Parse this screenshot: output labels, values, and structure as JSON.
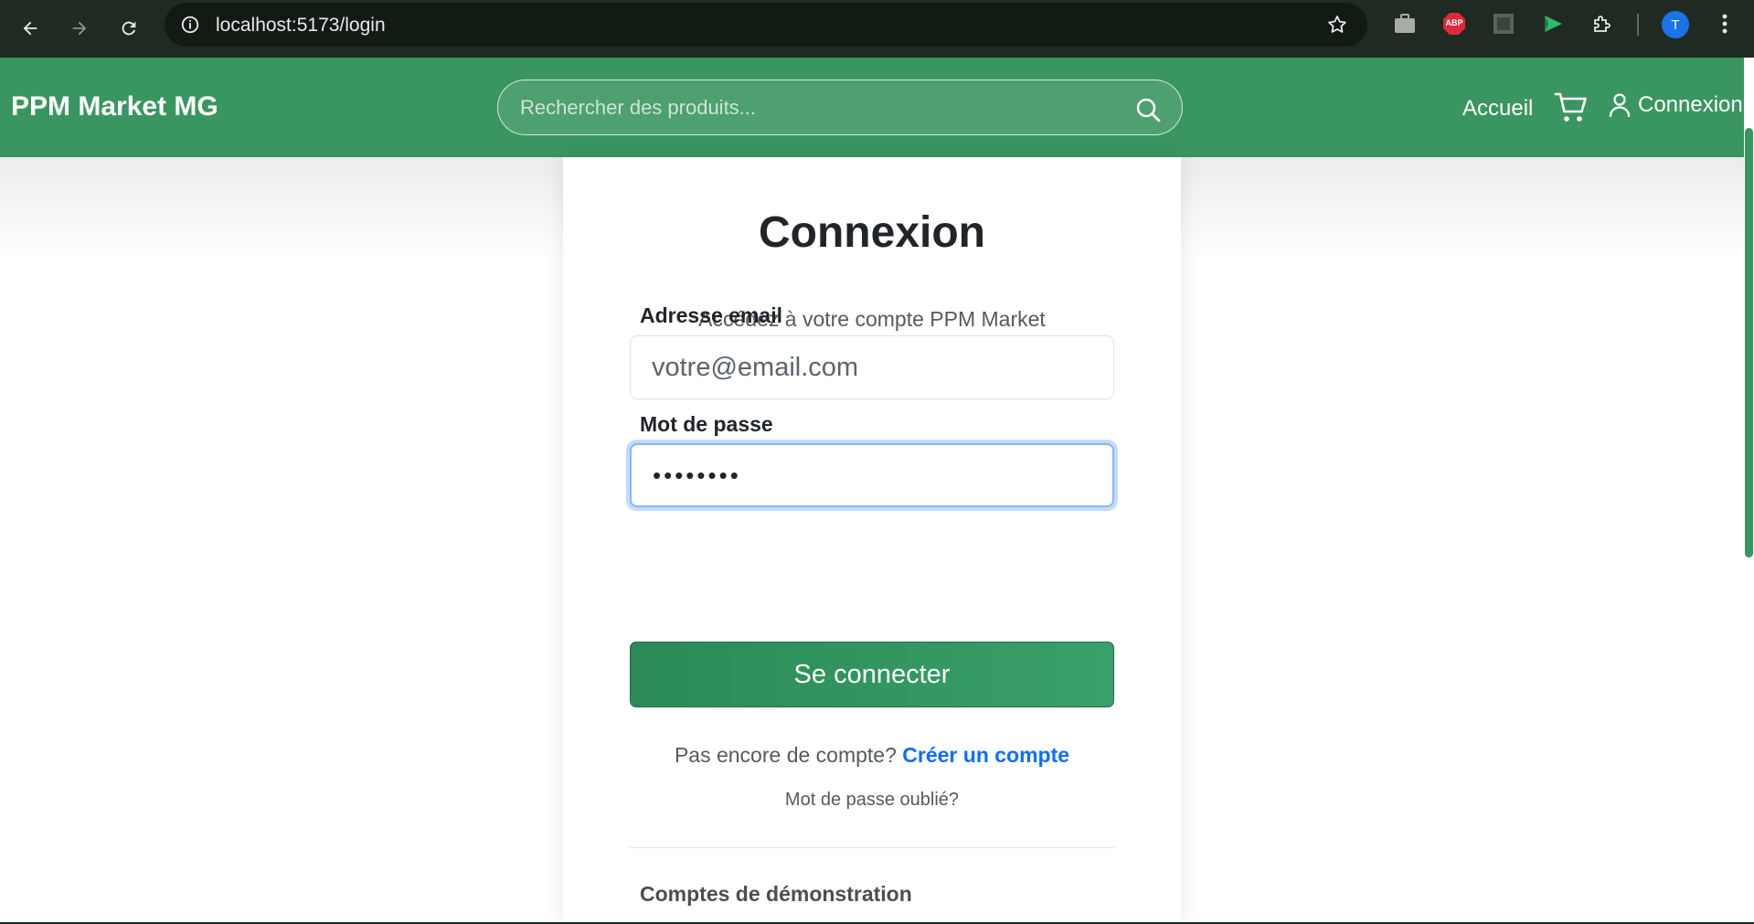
{
  "browser": {
    "url": "localhost:5173/login",
    "profile_initial": "T",
    "extensions": [
      "briefcase-icon",
      "adblock-plus-icon",
      "seo-icon",
      "send-icon",
      "puzzle-icon"
    ],
    "abp_label": "ABP"
  },
  "header": {
    "brand": "PPM Market MG",
    "search_placeholder": "Rechercher des produits...",
    "nav_home": "Accueil",
    "nav_login": "Connexion",
    "accent_color": "#3a9660"
  },
  "login": {
    "title": "Connexion",
    "subtitle": "Accédez à votre compte PPM Market",
    "email_label": "Adresse email",
    "email_placeholder": "votre@email.com",
    "password_label": "Mot de passe",
    "password_value": "••••••••",
    "submit_label": "Se connecter",
    "no_account_text": "Pas encore de compte?",
    "create_account_link": "Créer un compte",
    "forgot_password": "Mot de passe oublié?",
    "demo_title": "Comptes de démonstration"
  }
}
